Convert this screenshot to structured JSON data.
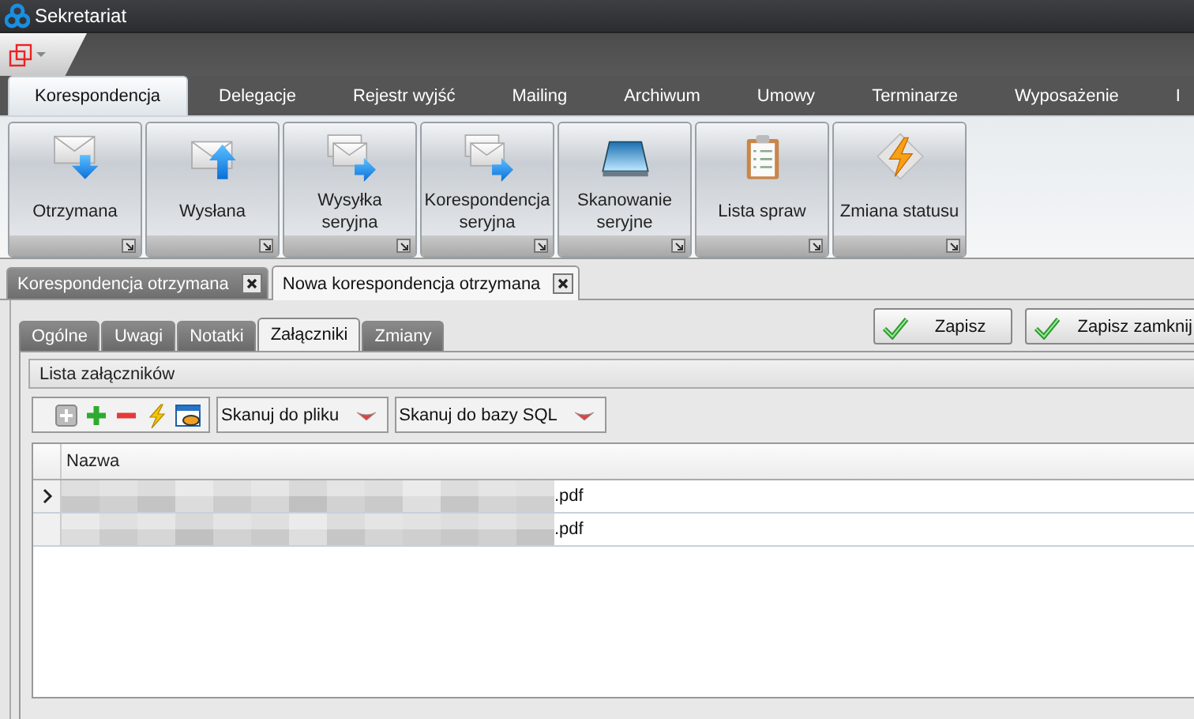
{
  "window": {
    "title": "Sekretariat"
  },
  "ribbon": {
    "tabs": [
      {
        "label": "Korespondencja",
        "selected": true
      },
      {
        "label": "Delegacje",
        "selected": false
      },
      {
        "label": "Rejestr wyjść",
        "selected": false
      },
      {
        "label": "Mailing",
        "selected": false
      },
      {
        "label": "Archiwum",
        "selected": false
      },
      {
        "label": "Umowy",
        "selected": false
      },
      {
        "label": "Terminarze",
        "selected": false
      },
      {
        "label": "Wyposażenie",
        "selected": false
      },
      {
        "label": "I",
        "selected": false
      }
    ],
    "buttons": [
      {
        "kind": "received",
        "lines": [
          "Otrzymana"
        ]
      },
      {
        "kind": "sent",
        "lines": [
          "Wysłana"
        ]
      },
      {
        "kind": "serial",
        "lines": [
          "Wysyłka",
          "seryjna"
        ]
      },
      {
        "kind": "serial",
        "lines": [
          "Korespondencja",
          "seryjna"
        ]
      },
      {
        "kind": "scan",
        "lines": [
          "Skanowanie",
          "seryjne"
        ]
      },
      {
        "kind": "list",
        "lines": [
          "Lista spraw"
        ]
      },
      {
        "kind": "status",
        "lines": [
          "Zmiana statusu"
        ]
      }
    ]
  },
  "document_tabs": [
    {
      "label": "Korespondencja otrzymana",
      "selected": false
    },
    {
      "label": "Nowa korespondencja otrzymana",
      "selected": true
    }
  ],
  "sub_tabs": [
    {
      "label": "Ogólne",
      "selected": false
    },
    {
      "label": "Uwagi",
      "selected": false
    },
    {
      "label": "Notatki",
      "selected": false
    },
    {
      "label": "Załączniki",
      "selected": true
    },
    {
      "label": "Zmiany",
      "selected": false
    }
  ],
  "actions": [
    "Zapisz",
    "Zapisz zamknij"
  ],
  "attachments": {
    "title": "Lista załączników",
    "scan_buttons": [
      "Skanuj do pliku",
      "Skanuj do bazy SQL"
    ],
    "table": {
      "columns": [
        "Nazwa"
      ],
      "rows": [
        {
          "name": ".pdf",
          "selected": true,
          "redacted": true
        },
        {
          "name": ".pdf",
          "selected": false,
          "redacted": true
        }
      ]
    }
  }
}
